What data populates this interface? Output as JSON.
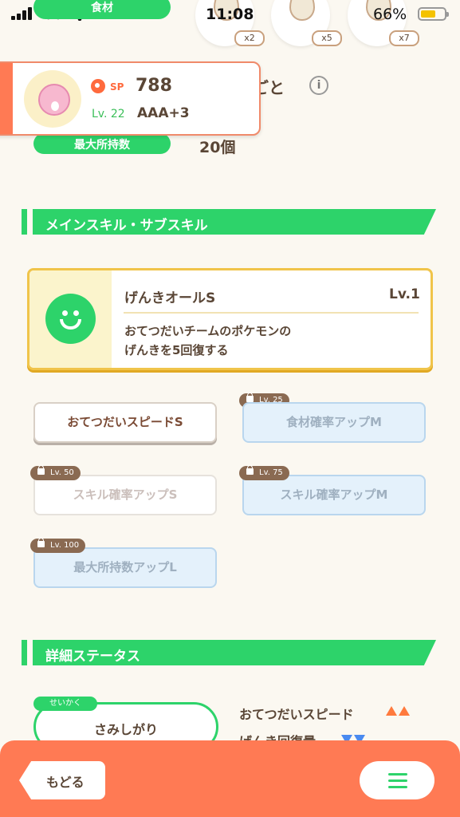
{
  "status_bar": {
    "carrier": "au",
    "time": "11:08",
    "battery_pct": "66%",
    "battery_level": 0.66
  },
  "top_residual": {
    "pill_label": "食材",
    "ingredients": [
      {
        "multiplier": "x2"
      },
      {
        "multiplier": "x5"
      },
      {
        "multiplier": "x7"
      }
    ]
  },
  "pokemon": {
    "sp_label": "SP",
    "sp": "788",
    "level": "Lv. 22",
    "rank": "AAA+3"
  },
  "section_partial": {
    "heading_tail": "ごと",
    "info_symbol": "i",
    "max_carry_label": "最大所持数",
    "max_carry_value": "20個"
  },
  "main_sub_header": "メインスキル・サブスキル",
  "main_skill": {
    "name": "げんきオールS",
    "level": "Lv.1",
    "desc_line1": "おてつだいチームのポケモンの",
    "desc_line2": "げんきを5回復する"
  },
  "sub_skills": [
    {
      "label": "おてつだいスピードS",
      "lock": ""
    },
    {
      "label": "食材確率アップM",
      "lock": "Lv. 25"
    },
    {
      "label": "スキル確率アップS",
      "lock": "Lv. 50"
    },
    {
      "label": "スキル確率アップM",
      "lock": "Lv. 75"
    },
    {
      "label": "最大所持数アップL",
      "lock": "Lv. 100"
    }
  ],
  "details_header": "詳細ステータス",
  "nature": {
    "tag": "せいかく",
    "value": "さみしがり",
    "up_stat": "おてつだいスピード",
    "down_stat": "げんき回復量"
  },
  "bottom": {
    "back": "もどる"
  },
  "colors": {
    "accent_green": "#2dd36a",
    "bottom_orange": "#ff7a54",
    "skill_gold": "#f0c44a"
  }
}
